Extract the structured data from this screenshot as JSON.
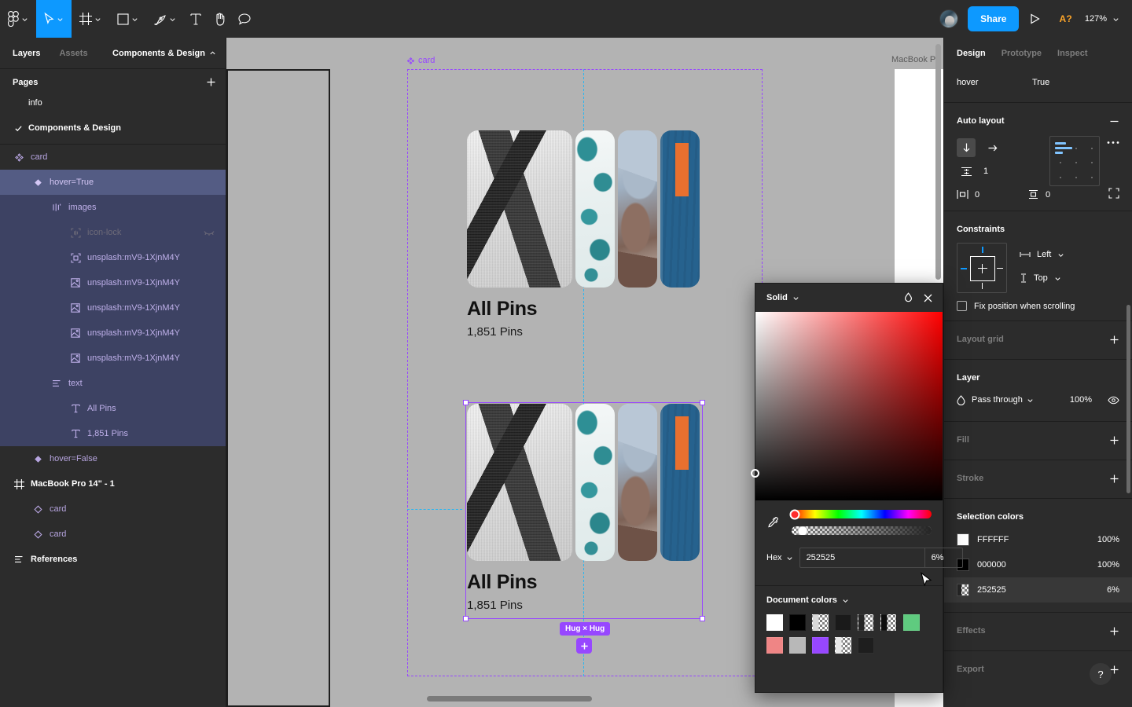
{
  "toolbar": {
    "menu_icon": "figma-logo-icon",
    "tools": [
      {
        "name": "move-tool",
        "icon": "cursor-icon",
        "active": true
      },
      {
        "name": "frame-tool",
        "icon": "frame-icon",
        "active": false
      },
      {
        "name": "shape-tool",
        "icon": "square-icon",
        "active": false
      },
      {
        "name": "pen-tool",
        "icon": "pen-icon",
        "active": false
      },
      {
        "name": "text-tool",
        "icon": "text-icon",
        "active": false
      },
      {
        "name": "hand-tool",
        "icon": "hand-icon",
        "active": false
      },
      {
        "name": "comment-tool",
        "icon": "comment-icon",
        "active": false
      }
    ],
    "share_label": "Share",
    "ab_badge": "A?",
    "zoom_level": "127%"
  },
  "left_panel": {
    "tabs": [
      {
        "label": "Layers",
        "active": true
      },
      {
        "label": "Assets",
        "active": false
      }
    ],
    "file_name": "Components & Design",
    "pages_header": "Pages",
    "pages": [
      {
        "label": "info",
        "selected": false
      },
      {
        "label": "Components & Design",
        "selected": true
      }
    ],
    "layers": [
      {
        "label": "card",
        "icon": "component-set-icon",
        "depth": 0,
        "style": "component",
        "state": "root"
      },
      {
        "label": "hover=True",
        "icon": "variant-icon",
        "depth": 1,
        "style": "component",
        "state": "selected"
      },
      {
        "label": "images",
        "icon": "autolayout-horizontal-icon",
        "depth": 2,
        "style": "component",
        "state": "child-selected"
      },
      {
        "label": "icon-lock",
        "icon": "component-instance-icon",
        "depth": 3,
        "style": "dim",
        "state": "child-selected",
        "hidden": true
      },
      {
        "label": "unsplash:mV9-1XjnM4Y",
        "icon": "mask-icon",
        "depth": 3,
        "style": "component",
        "state": "child-selected"
      },
      {
        "label": "unsplash:mV9-1XjnM4Y",
        "icon": "image-icon",
        "depth": 3,
        "style": "component",
        "state": "child-selected"
      },
      {
        "label": "unsplash:mV9-1XjnM4Y",
        "icon": "image-icon",
        "depth": 3,
        "style": "component",
        "state": "child-selected"
      },
      {
        "label": "unsplash:mV9-1XjnM4Y",
        "icon": "image-icon",
        "depth": 3,
        "style": "component",
        "state": "child-selected"
      },
      {
        "label": "unsplash:mV9-1XjnM4Y",
        "icon": "image-icon",
        "depth": 3,
        "style": "component",
        "state": "child-selected"
      },
      {
        "label": "text",
        "icon": "autolayout-vertical-icon",
        "depth": 2,
        "style": "component",
        "state": "child-selected"
      },
      {
        "label": "All Pins",
        "icon": "text-layer-icon",
        "depth": 3,
        "style": "component",
        "state": "child-selected"
      },
      {
        "label": "1,851 Pins",
        "icon": "text-layer-icon",
        "depth": 3,
        "style": "component",
        "state": "child-selected"
      },
      {
        "label": "hover=False",
        "icon": "variant-icon",
        "depth": 1,
        "style": "component",
        "state": "none"
      },
      {
        "label": "MacBook Pro 14\" - 1",
        "icon": "frame-icon",
        "depth": 0,
        "style": "white",
        "state": "none"
      },
      {
        "label": "card",
        "icon": "instance-icon",
        "depth": 1,
        "style": "component",
        "state": "none"
      },
      {
        "label": "card",
        "icon": "instance-icon",
        "depth": 1,
        "style": "component",
        "state": "none"
      },
      {
        "label": "References",
        "icon": "autolayout-vertical-icon",
        "depth": 0,
        "style": "white",
        "state": "none"
      }
    ]
  },
  "canvas": {
    "component_label": "card",
    "frame_label": "MacBook Pr",
    "cards": [
      {
        "title": "All Pins",
        "subtitle": "1,851 Pins"
      },
      {
        "title": "All Pins",
        "subtitle": "1,851 Pins"
      }
    ],
    "resize_badge": "Hug × Hug"
  },
  "right_panel": {
    "tabs": [
      {
        "label": "Design",
        "active": true
      },
      {
        "label": "Prototype",
        "active": false
      },
      {
        "label": "Inspect",
        "active": false
      }
    ],
    "variant_property": {
      "name": "hover",
      "value": "True"
    },
    "auto_layout": {
      "title": "Auto layout",
      "direction_vertical_icon": "arrow-down-icon",
      "direction_horizontal_icon": "arrow-right-icon",
      "gap_label": "1",
      "padding_horizontal": "0",
      "padding_vertical": "0",
      "more_icon": "ellipsis-icon",
      "collapse_icon": "minus-icon"
    },
    "constraints": {
      "title": "Constraints",
      "horizontal": "Left",
      "vertical": "Top",
      "fix_position_label": "Fix position when scrolling",
      "fix_position_checked": false
    },
    "layout_grid": {
      "title": "Layout grid",
      "add_icon": "plus-icon"
    },
    "layer": {
      "title": "Layer",
      "blend_mode": "Pass through",
      "opacity": "100%",
      "visibility_icon": "eye-icon"
    },
    "fill": {
      "title": "Fill",
      "add_icon": "plus-icon"
    },
    "stroke": {
      "title": "Stroke",
      "add_icon": "plus-icon"
    },
    "selection_colors": {
      "title": "Selection colors",
      "items": [
        {
          "hex": "FFFFFF",
          "opacity": "100%",
          "swatch": "#ffffff",
          "checker": false,
          "active": false
        },
        {
          "hex": "000000",
          "opacity": "100%",
          "swatch": "#000000",
          "checker": false,
          "active": false
        },
        {
          "hex": "252525",
          "opacity": "6%",
          "swatch": "#252525",
          "checker": true,
          "active": true
        }
      ]
    },
    "effects": {
      "title": "Effects",
      "add_icon": "plus-icon"
    },
    "export": {
      "title": "Export",
      "add_icon": "plus-icon"
    },
    "help_label": "?"
  },
  "color_picker": {
    "mode": "Solid",
    "mode_caret_icon": "chevron-down-icon",
    "libraries_icon": "color-styles-icon",
    "close_icon": "close-icon",
    "eyedropper_icon": "eyedropper-icon",
    "format_label": "Hex",
    "hex_value": "252525",
    "alpha_value": "6%",
    "document_colors_label": "Document colors",
    "document_colors": [
      "#ffffff",
      "#000000",
      "#d9d9d9",
      "#1a1a1a",
      "#252525",
      "#0d0d0d",
      "#5fcb7f",
      "#ef8585",
      "#b8b8b8",
      "#9747ff",
      "#e8e8e8",
      "#1e1e1e"
    ],
    "document_colors_checker": [
      false,
      false,
      true,
      false,
      true,
      true,
      false,
      false,
      false,
      false,
      true,
      false
    ]
  }
}
